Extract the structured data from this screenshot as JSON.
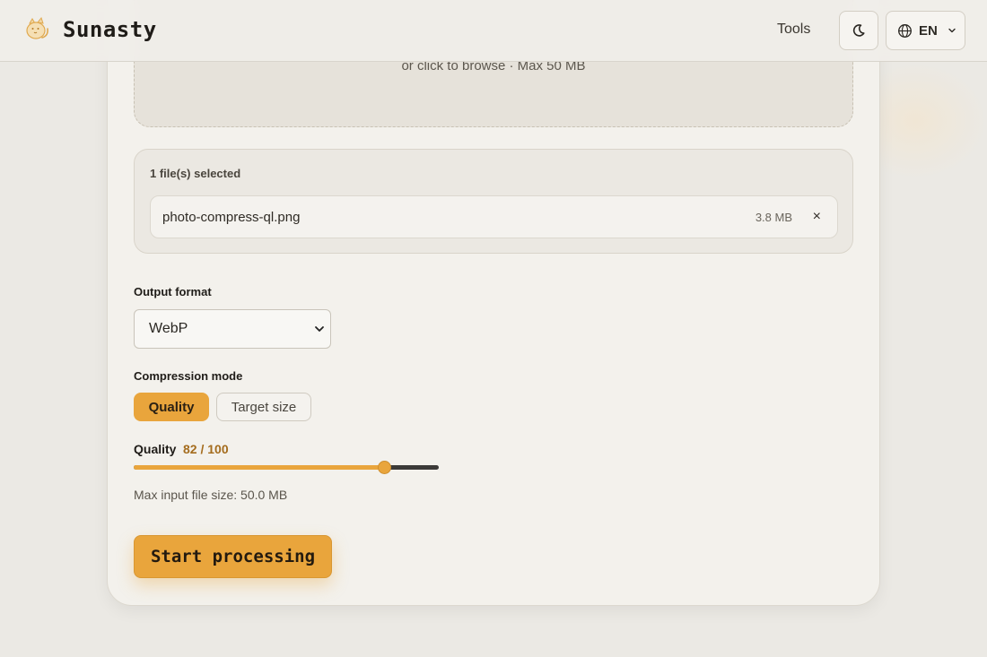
{
  "header": {
    "brand": "Sunasty",
    "nav_tools": "Tools",
    "theme_icon": "moon-icon",
    "lang": "EN",
    "lang_icon": "globe-icon"
  },
  "dropzone": {
    "subtitle": "or click to browse · Max 50 MB"
  },
  "files": {
    "count_label": "1 file(s) selected",
    "items": [
      {
        "name": "photo-compress-ql.png",
        "size": "3.8 MB"
      }
    ],
    "remove_label": "×"
  },
  "form": {
    "output_format_label": "Output format",
    "output_format_value": "WebP",
    "compression_mode_label": "Compression mode",
    "modes": [
      "Quality",
      "Target size"
    ],
    "active_mode": "Quality",
    "quality_label": "Quality",
    "quality_value": 82,
    "quality_max": 100,
    "quality_display": "82 / 100",
    "max_input_note": "Max input file size: 50.0 MB",
    "start_label": "Start processing"
  },
  "colors": {
    "accent": "#e9a53c",
    "accent_text": "#a46c1d",
    "background": "#ebe9e4",
    "card": "#f3f1ec"
  }
}
